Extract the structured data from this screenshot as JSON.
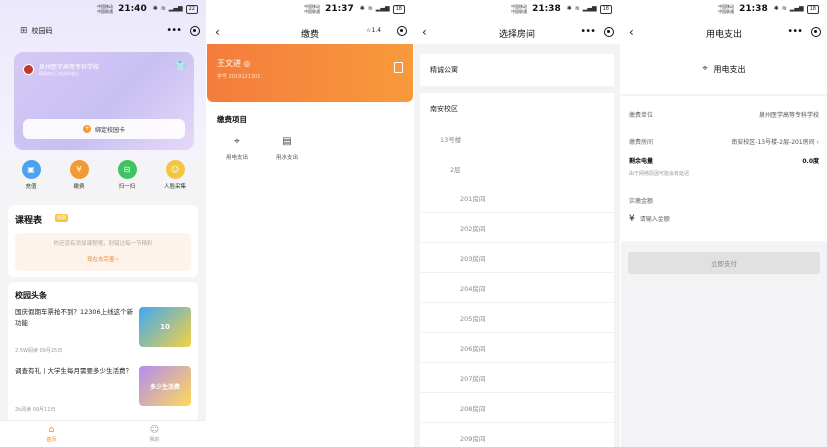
{
  "screens": [
    {
      "status": {
        "carrier1": "中国移动",
        "carrier2": "中国联通",
        "time": "21:40",
        "battery": "22"
      },
      "campus_code": "校园码",
      "card": {
        "school": "泉州医学高等专科学校",
        "subtitle": "精确的自己做具体量位",
        "bind_label": "绑定校园卡"
      },
      "quick_actions": [
        {
          "label": "充值",
          "icon": "recharge-icon",
          "color": "#4aa3f0"
        },
        {
          "label": "缴费",
          "icon": "yen-icon",
          "color": "#f39a37"
        },
        {
          "label": "扫一扫",
          "icon": "scan-icon",
          "color": "#3fc25f"
        },
        {
          "label": "人脸采集",
          "icon": "face-icon",
          "color": "#f5c542"
        }
      ],
      "schedule": {
        "title": "课程表",
        "badge": "假期",
        "hint": "你还没有添加课程哦，别错过每一节精彩",
        "link": "现在去完善~"
      },
      "news": {
        "title": "校园头条",
        "items": [
          {
            "text": "国庆假期车票抢不到？12306上线这个新功能",
            "meta": "2.5W阅读   09月25日",
            "thumb": "10",
            "color": "#3fa9f5"
          },
          {
            "text": "调查有礼丨大学生每月需要多少生活费？",
            "meta": "2k阅读   09月11日",
            "thumb": "多少生活费",
            "color": "#b38cf0"
          }
        ]
      },
      "tabs": [
        {
          "label": "首页"
        },
        {
          "label": "我的"
        }
      ]
    },
    {
      "status": {
        "carrier1": "中国移动",
        "carrier2": "中国联通",
        "time": "21:37",
        "battery": "18"
      },
      "title": "缴费",
      "star": "☆1.4",
      "student": {
        "name": "王文进",
        "id": "学号 2019121301"
      },
      "items_title": "缴费项目",
      "items": [
        {
          "label": "用电支出"
        },
        {
          "label": "用水支出"
        }
      ]
    },
    {
      "status": {
        "carrier1": "中国移动",
        "carrier2": "中国联通",
        "time": "21:38",
        "battery": "18"
      },
      "title": "选择房间",
      "apartment": "精诚公寓",
      "campus": "南安校区",
      "building": "13号楼",
      "floor": "2层",
      "rooms": [
        "201房间",
        "202房间",
        "203房间",
        "204房间",
        "205房间",
        "206房间",
        "207房间",
        "208房间",
        "209房间"
      ]
    },
    {
      "status": {
        "carrier1": "中国移动",
        "carrier2": "中国联通",
        "time": "21:38",
        "battery": "18"
      },
      "title": "用电支出",
      "header": "用电支出",
      "unit_label": "缴费单位",
      "unit_value": "泉州医学高等专科学校",
      "room_label": "缴费房间",
      "room_value": "南安校区-13号楼-2层-201房间",
      "balance_label": "剩余电量",
      "balance_value": "0.0度",
      "balance_hint": "由于网络原因可能会有延迟",
      "amount_label": "实缴金额",
      "amount_placeholder": "请输入金额",
      "pay_label": "立即支付"
    }
  ]
}
